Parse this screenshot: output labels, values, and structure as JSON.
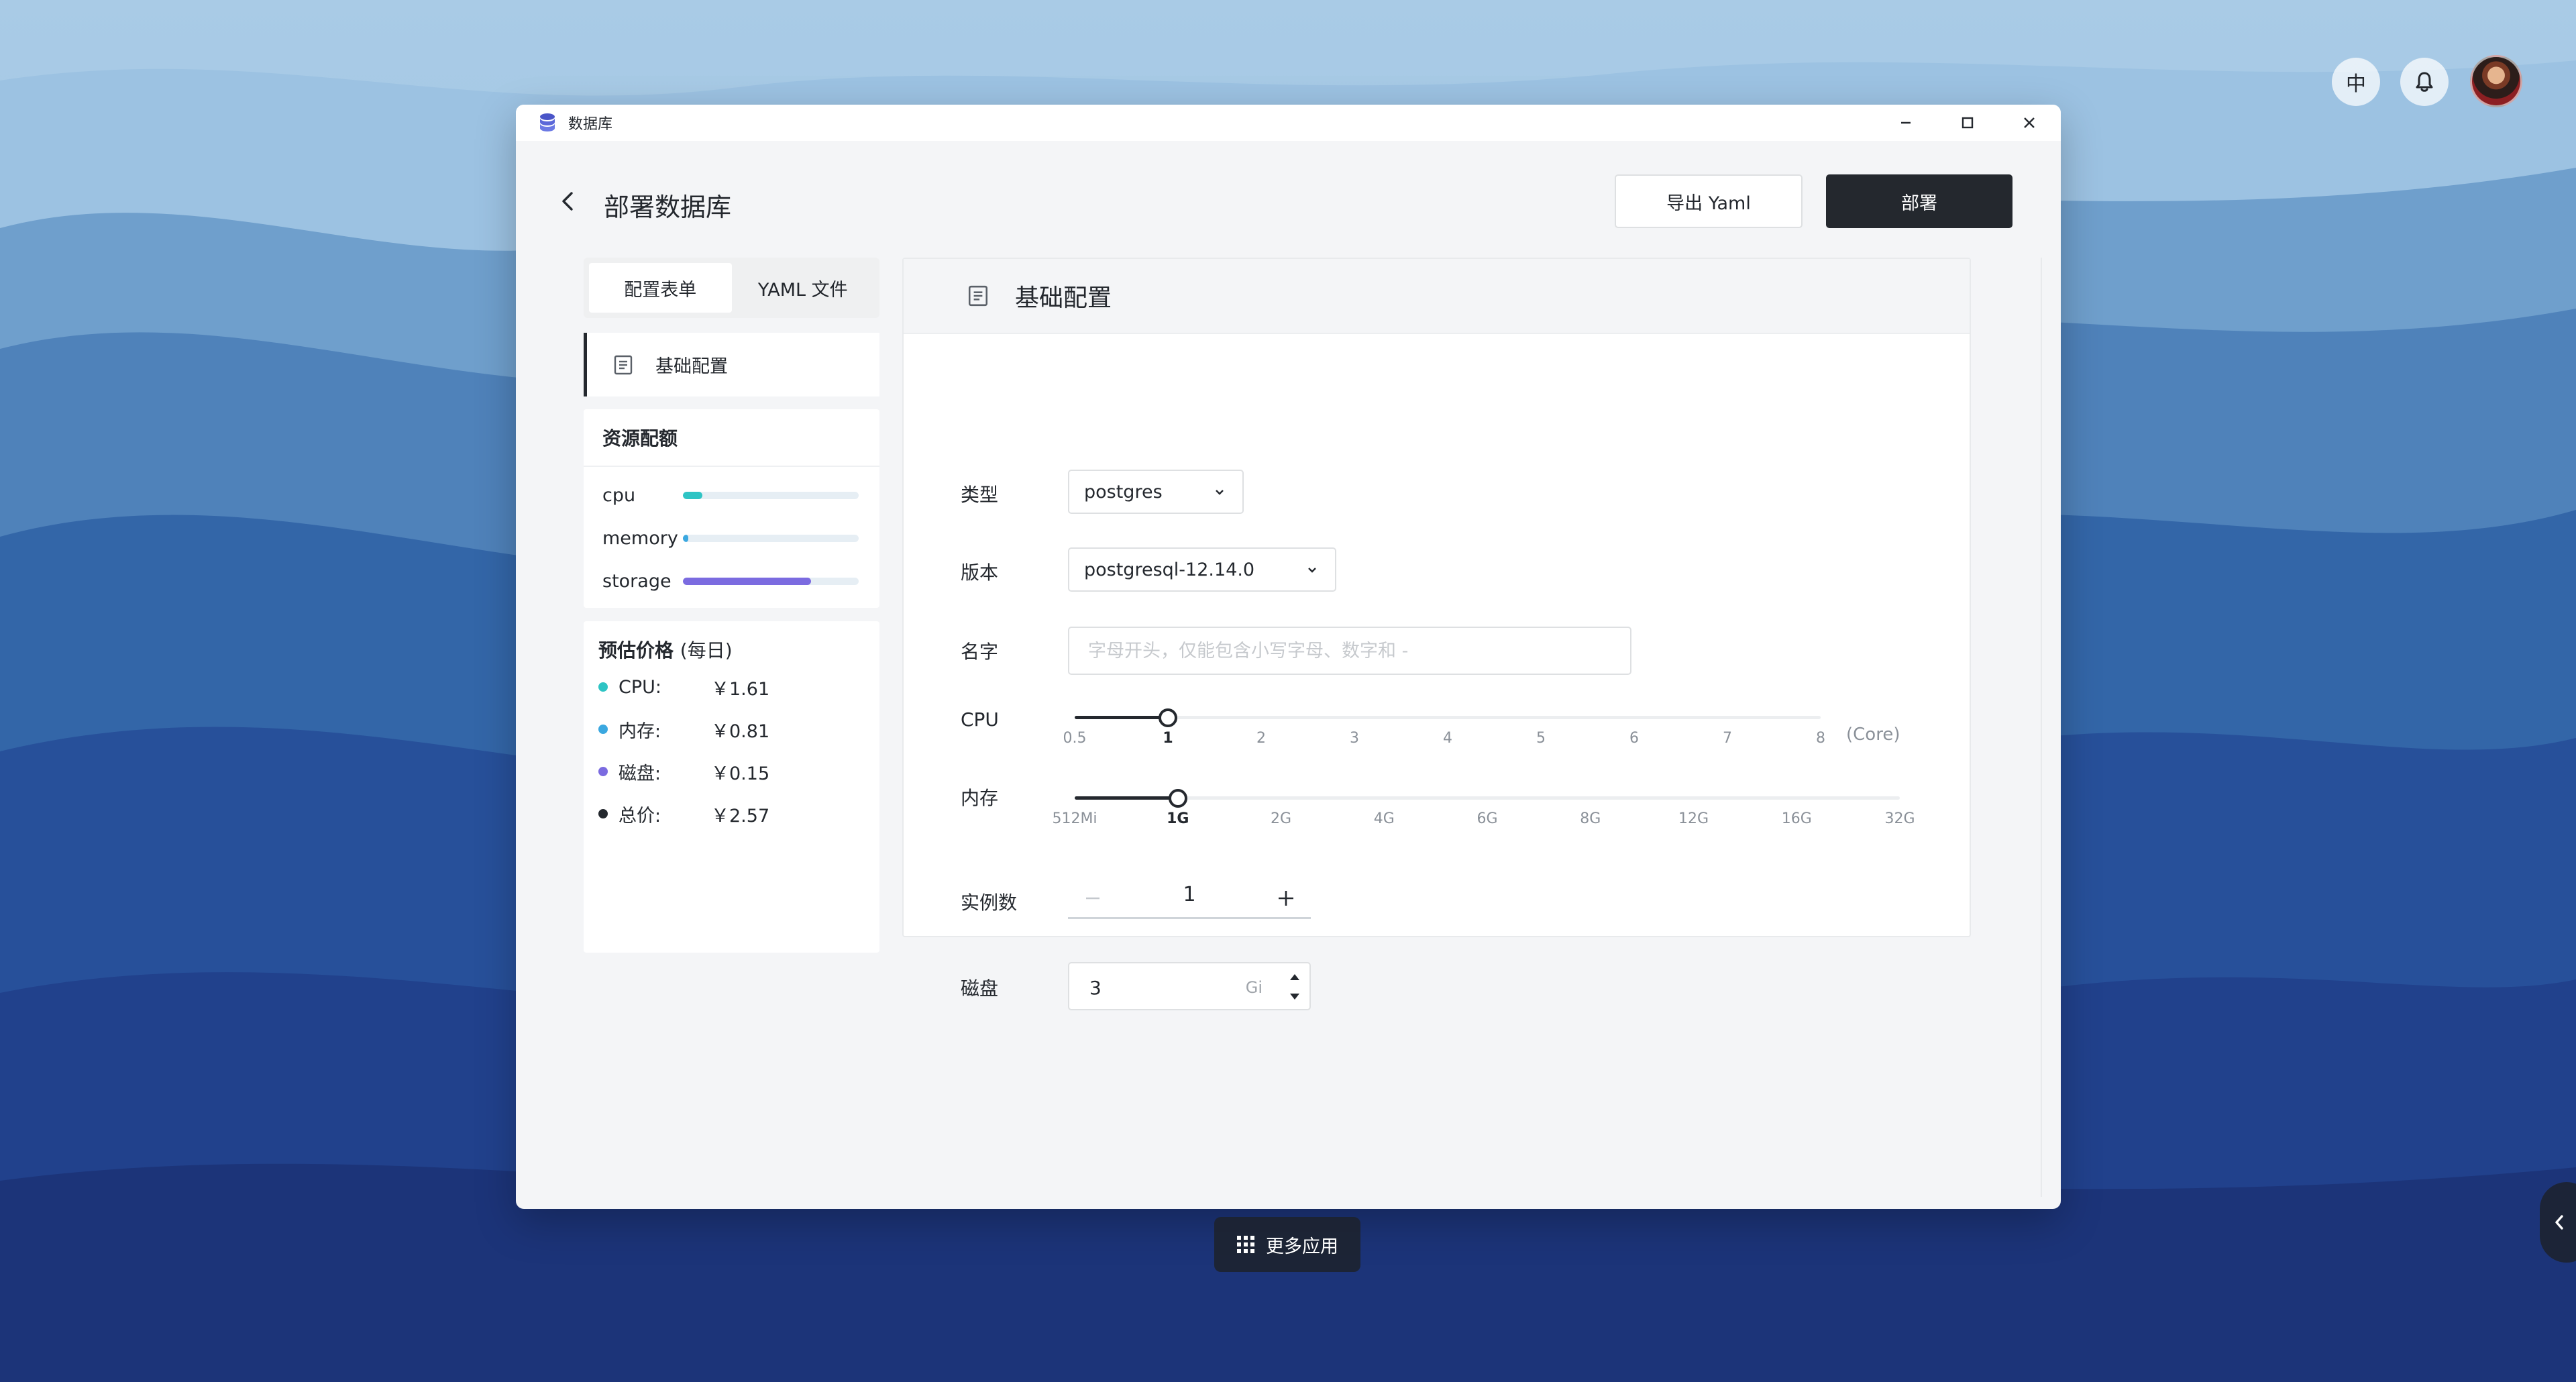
{
  "colors": {
    "accent_dark": "#24282e",
    "cpu": "#2ec4c4",
    "memory": "#3ba8e0",
    "storage": "#7b6be0",
    "total": "#24282e"
  },
  "desktop": {
    "language_button": "中",
    "bell_icon": "bell-icon",
    "more_apps_label": "更多应用"
  },
  "window": {
    "app_title": "数据库",
    "controls": [
      "minimize-icon",
      "maximize-icon",
      "close-icon"
    ]
  },
  "header": {
    "title": "部署数据库",
    "export_label": "导出 Yaml",
    "deploy_label": "部署"
  },
  "tabs": [
    {
      "label": "配置表单",
      "active": true
    },
    {
      "label": "YAML 文件",
      "active": false
    }
  ],
  "nav": {
    "item_label": "基础配置"
  },
  "quota": {
    "title": "资源配额",
    "items": [
      {
        "label": "cpu",
        "fraction": 0.11,
        "color": "#2ec4c4"
      },
      {
        "label": "memory",
        "fraction": 0.03,
        "color": "#3ba8e0"
      },
      {
        "label": "storage",
        "fraction": 0.73,
        "color": "#7b6be0"
      }
    ]
  },
  "price": {
    "title": "预估价格",
    "subtitle": "(每日)",
    "items": [
      {
        "label": "CPU:",
        "value": "￥1.61",
        "color": "#2ec4c4"
      },
      {
        "label": "内存:",
        "value": "￥0.81",
        "color": "#3ba8e0"
      },
      {
        "label": "磁盘:",
        "value": "￥0.15",
        "color": "#7b6be0"
      },
      {
        "label": "总价:",
        "value": "￥2.57",
        "color": "#24282e"
      }
    ]
  },
  "form": {
    "section_title": "基础配置",
    "type": {
      "label": "类型",
      "value": "postgres"
    },
    "version": {
      "label": "版本",
      "value": "postgresql-12.14.0"
    },
    "name": {
      "label": "名字",
      "placeholder": "字母开头，仅能包含小写字母、数字和 -",
      "value": ""
    },
    "cpu": {
      "label": "CPU",
      "ticks": [
        "0.5",
        "1",
        "2",
        "3",
        "4",
        "5",
        "6",
        "7",
        "8"
      ],
      "selected_index": 1,
      "unit": "(Core)"
    },
    "memory": {
      "label": "内存",
      "ticks": [
        "512Mi",
        "1G",
        "2G",
        "4G",
        "6G",
        "8G",
        "12G",
        "16G",
        "32G"
      ],
      "selected_index": 1
    },
    "replicas": {
      "label": "实例数",
      "value": "1"
    },
    "disk": {
      "label": "磁盘",
      "value": "3",
      "unit": "Gi"
    }
  }
}
